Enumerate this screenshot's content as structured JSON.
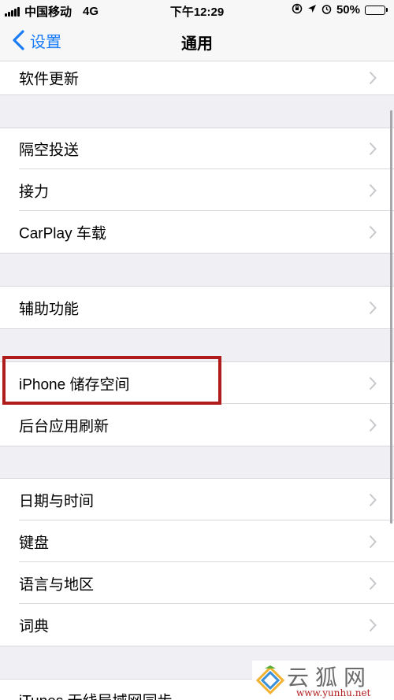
{
  "status_bar": {
    "carrier": "中国移动",
    "network": "4G",
    "time": "下午12:29",
    "battery_text": "50%",
    "battery_level": 0.5
  },
  "nav": {
    "back_label": "设置",
    "title": "通用"
  },
  "rows": {
    "software_update": "软件更新",
    "airdrop": "隔空投送",
    "handoff": "接力",
    "carplay": "CarPlay 车载",
    "accessibility": "辅助功能",
    "iphone_storage": "iPhone 储存空间",
    "background_refresh": "后台应用刷新",
    "date_time": "日期与时间",
    "keyboard": "键盘",
    "language_region": "语言与地区",
    "dictionary": "词典",
    "itunes_wifi_sync": "iTunes 无线局域网同步"
  },
  "watermark": {
    "text": "云狐网",
    "url": "www.yunhu.net"
  },
  "colors": {
    "accent": "#1a7cf5",
    "highlight": "#b01b1b",
    "background": "#efeff4"
  }
}
